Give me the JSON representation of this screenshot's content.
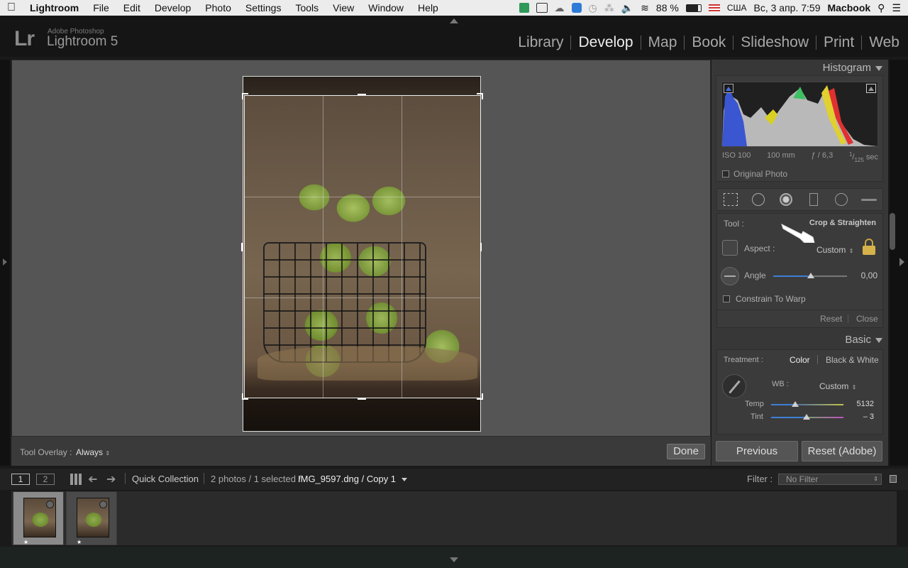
{
  "menubar": {
    "apple": "",
    "app": "Lightroom",
    "items": [
      "File",
      "Edit",
      "Develop",
      "Photo",
      "Settings",
      "Tools",
      "View",
      "Window",
      "Help"
    ],
    "battery": "88 %",
    "locale": "США",
    "datetime": "Вс, 3 апр.  7:59",
    "user": "Macbook"
  },
  "brand": {
    "logo": "Lr",
    "vendor": "Adobe Photoshop",
    "product": "Lightroom 5"
  },
  "modules": [
    {
      "label": "Library"
    },
    {
      "label": "Develop",
      "active": true
    },
    {
      "label": "Map"
    },
    {
      "label": "Book"
    },
    {
      "label": "Slideshow"
    },
    {
      "label": "Print"
    },
    {
      "label": "Web"
    }
  ],
  "toolbar": {
    "overlay_label": "Tool Overlay :",
    "overlay_value": "Always",
    "done": "Done"
  },
  "histogram": {
    "title": "Histogram",
    "iso": "ISO 100",
    "focal": "100 mm",
    "aperture": "ƒ / 6,3",
    "shutter_num": "1",
    "shutter_den": "125",
    "shutter_unit": "sec",
    "original_photo": "Original Photo"
  },
  "crop": {
    "tool_label": "Tool :",
    "tool_value": "Crop & Straighten",
    "aspect_label": "Aspect :",
    "aspect_value": "Custom",
    "angle_label": "Angle",
    "angle_value": "0,00",
    "constrain": "Constrain To Warp",
    "reset": "Reset",
    "close": "Close"
  },
  "basic": {
    "title": "Basic",
    "treatment_label": "Treatment :",
    "color": "Color",
    "bw": "Black & White",
    "wb_label": "WB :",
    "wb_value": "Custom",
    "temp_label": "Temp",
    "temp_value": "5132",
    "tint_label": "Tint",
    "tint_value": "– 3"
  },
  "buttons": {
    "previous": "Previous",
    "reset": "Reset (Adobe)"
  },
  "filmbar": {
    "page1": "1",
    "page2": "2",
    "source": "Quick Collection",
    "count": "2 photos / 1 selected /",
    "filename": "IMG_9597.dng / Copy 1",
    "filter_label": "Filter :",
    "filter_value": "No Filter"
  },
  "colors": {
    "accent": "#4a8fe0",
    "panel": "#373737",
    "background": "#1a1a1a"
  }
}
